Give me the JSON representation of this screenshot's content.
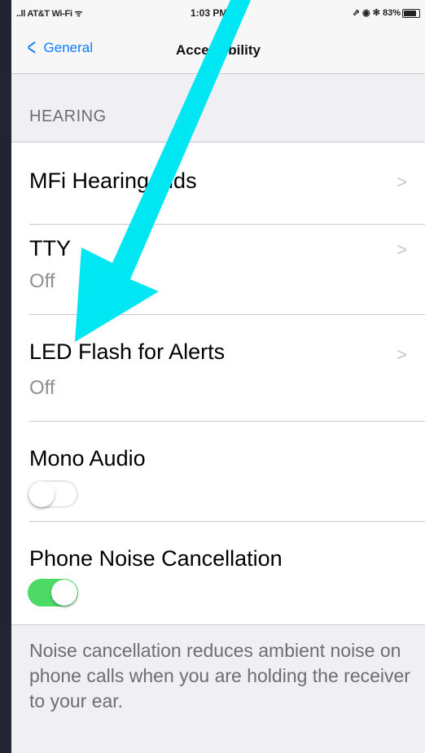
{
  "status_bar": {
    "carrier": "..ll AT&T Wi-Fi ᯤ",
    "time": "1:03 PM",
    "right_icons": "⇗ ◉ ✻ 83%"
  },
  "nav": {
    "back_label": "General",
    "title": "Accessibility"
  },
  "section_header": "HEARING",
  "rows": [
    {
      "label": "MFi Hearing Aids"
    },
    {
      "label": "TTY",
      "value": "Off"
    },
    {
      "label": "LED Flash for Alerts",
      "value": "Off"
    },
    {
      "label": "Mono Audio",
      "toggle": "off"
    },
    {
      "label": "Phone Noise Cancellation",
      "toggle": "on"
    }
  ],
  "footer_text": "Noise cancellation reduces ambient noise on phone calls when you are holding the receiver to your ear.",
  "colors": {
    "accent": "#0a7cff",
    "toggle_on": "#4cd964",
    "annotation_arrow": "#00e6f2"
  },
  "icons": [
    "back-chevron-icon",
    "chevron-right-icon",
    "battery-icon",
    "annotation-arrow"
  ]
}
